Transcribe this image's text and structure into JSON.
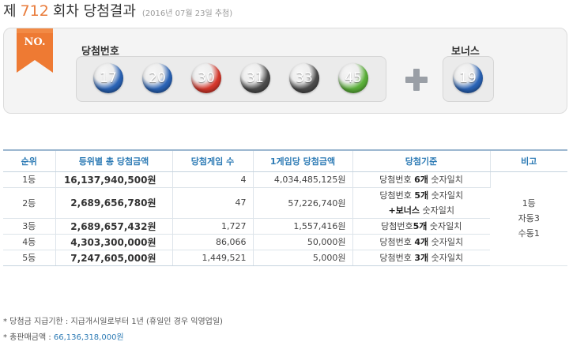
{
  "header": {
    "prefix": "제",
    "round": "712",
    "suffix": "회차 당첨결과",
    "date": "(2016년 07월 23일 추첨)"
  },
  "draw": {
    "badge": "NO.",
    "numbers_label": "당첨번호",
    "bonus_label": "보너스",
    "numbers": [
      "17",
      "20",
      "30",
      "31",
      "33",
      "45"
    ],
    "bonus": "19",
    "colors": {
      "blue": "#2a64b8",
      "red": "#d8382c",
      "gray": "#4d4d4d",
      "green": "#5cb23a",
      "ribbon": "#ee7a33"
    }
  },
  "table": {
    "headers": [
      "순위",
      "등위별 총 당첨금액",
      "당첨게임 수",
      "1게임당 당첨금액",
      "당첨기준",
      "비고"
    ],
    "rows": [
      {
        "rank": "1등",
        "total": "16,137,940,500원",
        "winners": "4",
        "per_game": "4,034,485,125원",
        "crit_prefix": "당첨번호 ",
        "crit_bold": "6개",
        "crit_suffix": " 숫자일치",
        "crit_line2": ""
      },
      {
        "rank": "2등",
        "total": "2,689,656,780원",
        "winners": "47",
        "per_game": "57,226,740원",
        "crit_prefix": "당첨번호 ",
        "crit_bold": "5개",
        "crit_suffix": " 숫자일치",
        "crit_line2_bold": "+보너스",
        "crit_line2": " 숫자일치"
      },
      {
        "rank": "3등",
        "total": "2,689,657,432원",
        "winners": "1,727",
        "per_game": "1,557,416원",
        "crit_prefix": "당첨번호",
        "crit_bold": "5개",
        "crit_suffix": " 숫자일치",
        "crit_line2": ""
      },
      {
        "rank": "4등",
        "total": "4,303,300,000원",
        "winners": "86,066",
        "per_game": "50,000원",
        "crit_prefix": "당첨번호 ",
        "crit_bold": "4개",
        "crit_suffix": " 숫자일치",
        "crit_line2": ""
      },
      {
        "rank": "5등",
        "total": "7,247,605,000원",
        "winners": "1,449,521",
        "per_game": "5,000원",
        "crit_prefix": "당첨번호 ",
        "crit_bold": "3개",
        "crit_suffix": " 숫자일치",
        "crit_line2": ""
      }
    ],
    "note": [
      "1등",
      "자동3",
      "수동1"
    ]
  },
  "footer": {
    "deadline": "* 당첨금 지급기한 : 지급개시일로부터 1년 (휴일인 경우 익영업일)",
    "sales_label": "* 총판매금액 : ",
    "sales_value": "66,136,318,000원"
  }
}
